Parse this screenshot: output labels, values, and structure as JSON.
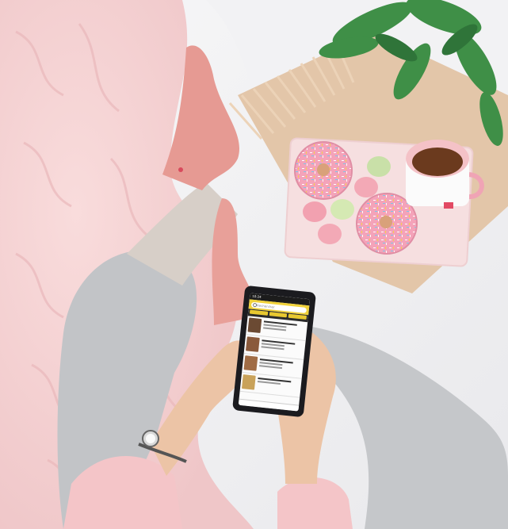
{
  "scene": {
    "phone": {
      "status_time": "10:24",
      "search_placeholder": "Rechercher"
    }
  }
}
